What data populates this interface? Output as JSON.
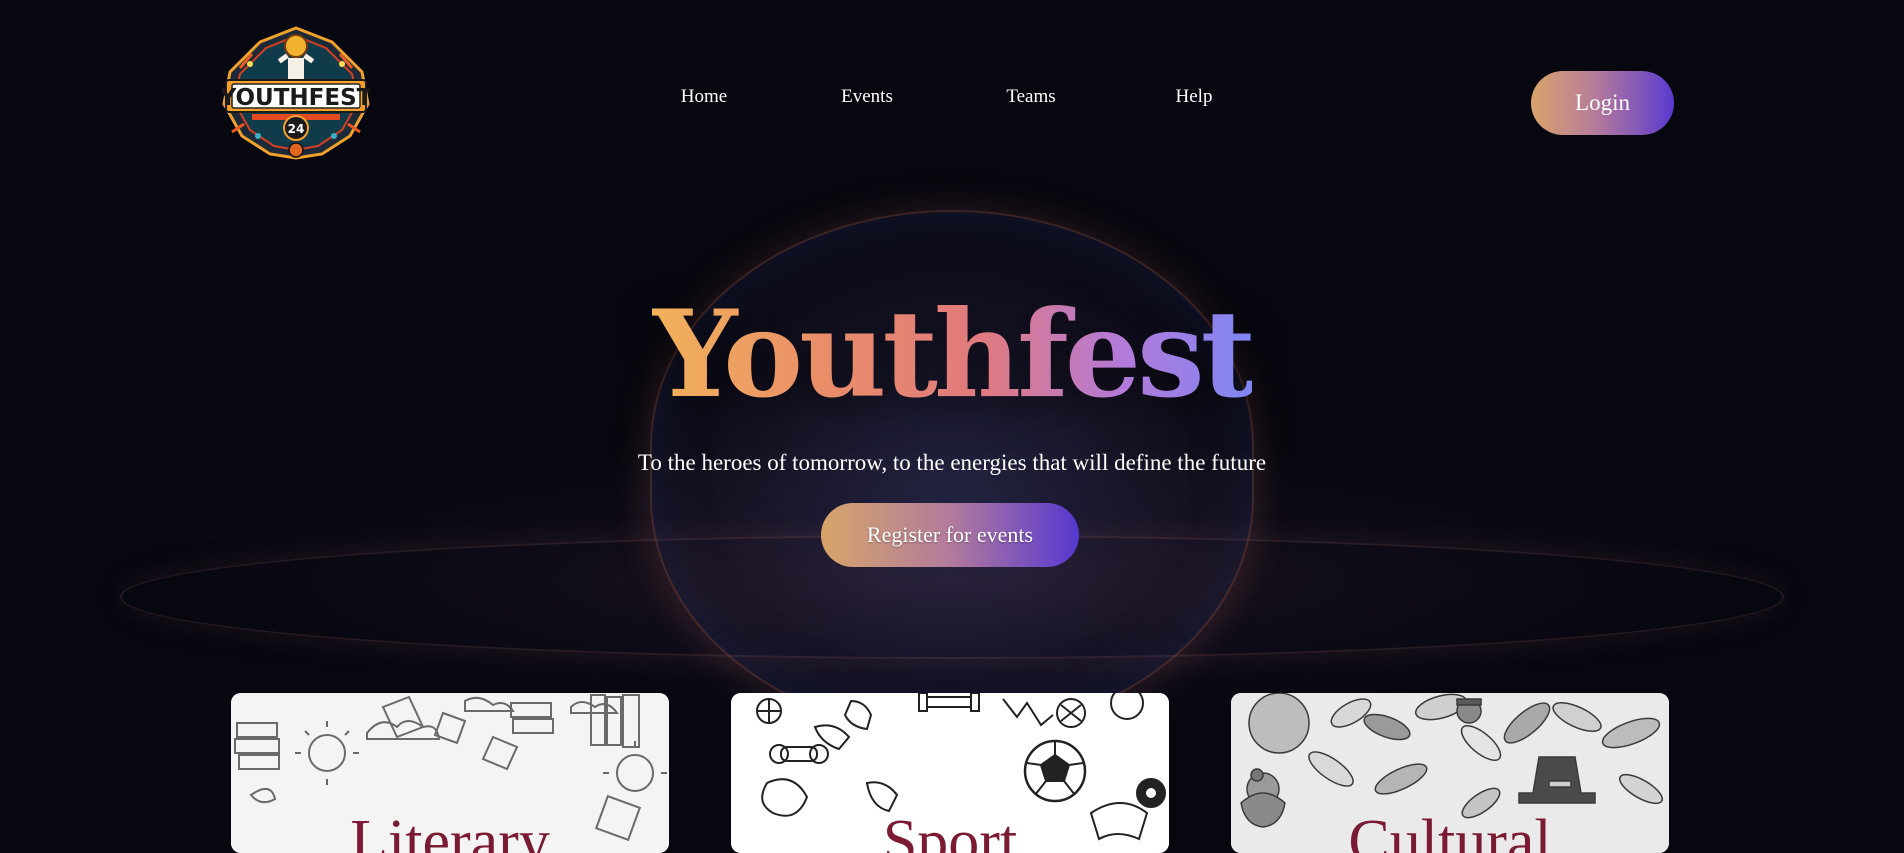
{
  "brand": {
    "logo_text": "YOUTHFEST",
    "logo_year": "24"
  },
  "nav": {
    "items": [
      {
        "label": "Home"
      },
      {
        "label": "Events"
      },
      {
        "label": "Teams"
      },
      {
        "label": "Help"
      }
    ],
    "login_label": "Login"
  },
  "hero": {
    "title": "Youthfest",
    "subtitle": "To the heroes of tomorrow, to the energies that will define the future",
    "cta_label": "Register for events"
  },
  "categories": [
    {
      "title": "Literary"
    },
    {
      "title": "Sport"
    },
    {
      "title": "Cultural"
    }
  ],
  "colors": {
    "background": "#07070f",
    "gradient_start": "#d9a46b",
    "gradient_end": "#5a3ad0",
    "card_title": "#7b1a33"
  }
}
